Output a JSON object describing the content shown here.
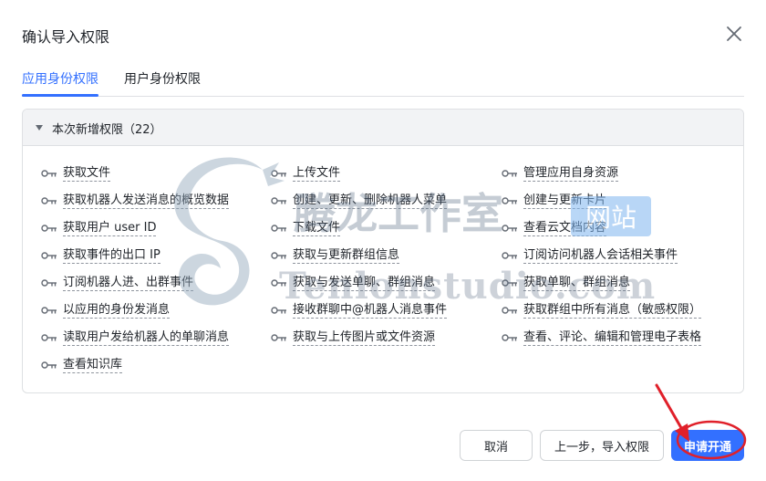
{
  "dialog": {
    "title": "确认导入权限"
  },
  "tabs": [
    {
      "label": "应用身份权限",
      "active": true
    },
    {
      "label": "用户身份权限",
      "active": false
    }
  ],
  "section": {
    "title": "本次新增权限（22）",
    "expanded": true
  },
  "permissions": [
    [
      "获取文件",
      "上传文件",
      "管理应用自身资源"
    ],
    [
      "获取机器人发送消息的概览数据",
      "创建、更新、删除机器人菜单",
      "创建与更新卡片"
    ],
    [
      "获取用户 user ID",
      "下载文件",
      "查看云文档内容"
    ],
    [
      "获取事件的出口 IP",
      "获取与更新群组信息",
      "订阅访问机器人会话相关事件"
    ],
    [
      "订阅机器人进、出群事件",
      "获取与发送单聊、群组消息",
      "获取单聊、群组消息"
    ],
    [
      "以应用的身份发消息",
      "接收群聊中@机器人消息事件",
      "获取群组中所有消息（敏感权限）"
    ],
    [
      "读取用户发给机器人的单聊消息",
      "获取与上传图片或文件资源",
      "查看、评论、编辑和管理电子表格"
    ],
    [
      "查看知识库"
    ]
  ],
  "buttons": {
    "cancel": "取消",
    "previous": "上一步，导入权限",
    "apply": "申请开通"
  },
  "watermark": {
    "title": "腾龙工作室",
    "badge": "网站",
    "domain": "Tenlonstudio.com"
  },
  "colors": {
    "accent": "#3370ff",
    "annotation": "#e0202a"
  }
}
